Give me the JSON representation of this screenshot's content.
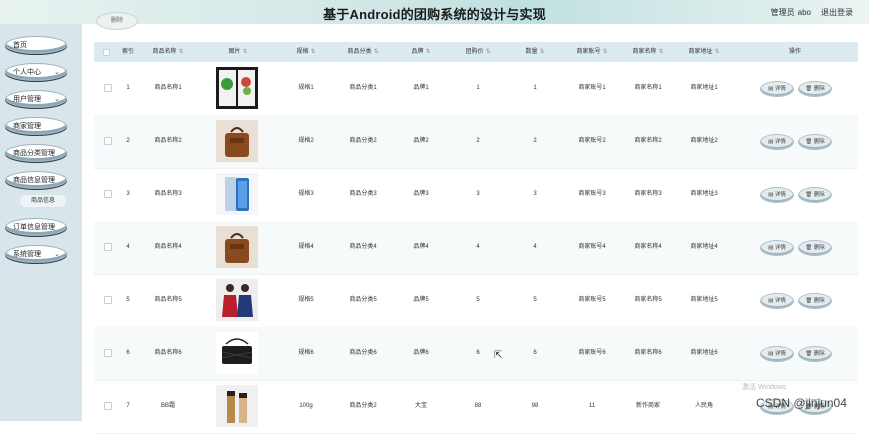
{
  "header": {
    "title": "基于Android的团购系统的设计与实现",
    "role": "管理员",
    "username": "abo",
    "logout": "退出登录"
  },
  "sidebar": {
    "items": [
      {
        "label": "首页",
        "chevron": ""
      },
      {
        "label": "个人中心",
        "chevron": "⌄"
      },
      {
        "label": "用户管理",
        "chevron": "⌄"
      },
      {
        "label": "商家管理",
        "chevron": ""
      },
      {
        "label": "商品分类管理",
        "chevron": ""
      },
      {
        "label": "商品信息管理",
        "chevron": ""
      },
      {
        "label": "订单信息管理",
        "chevron": ""
      },
      {
        "label": "系统管理",
        "chevron": "⌄"
      }
    ],
    "subitem": "商品信息"
  },
  "toolbar": {
    "button": "删除"
  },
  "table": {
    "columns": [
      "",
      "索引",
      "商品名称",
      "图片",
      "规格",
      "商品分类",
      "品牌",
      "团购价",
      "数量",
      "商家账号",
      "商家名称",
      "商家地址",
      "操作"
    ],
    "rows": [
      {
        "idx": "1",
        "name": "商品名称1",
        "image": "vegetables",
        "spec": "规格1",
        "cat": "商品分类1",
        "brand": "品牌1",
        "price": "1",
        "qty": "1",
        "acct": "商家账号1",
        "mname": "商家名称1",
        "addr": "商家地址1"
      },
      {
        "idx": "2",
        "name": "商品名称2",
        "image": "brown-bag",
        "spec": "规格2",
        "cat": "商品分类2",
        "brand": "品牌2",
        "price": "2",
        "qty": "2",
        "acct": "商家账号2",
        "mname": "商家名称2",
        "addr": "商家地址2"
      },
      {
        "idx": "3",
        "name": "商品名称3",
        "image": "phone",
        "spec": "规格3",
        "cat": "商品分类3",
        "brand": "品牌3",
        "price": "3",
        "qty": "3",
        "acct": "商家账号3",
        "mname": "商家名称3",
        "addr": "商家地址3"
      },
      {
        "idx": "4",
        "name": "商品名称4",
        "image": "brown-bag",
        "spec": "规格4",
        "cat": "商品分类4",
        "brand": "品牌4",
        "price": "4",
        "qty": "4",
        "acct": "商家账号4",
        "mname": "商家名称4",
        "addr": "商家地址4"
      },
      {
        "idx": "5",
        "name": "商品名称5",
        "image": "clothing",
        "spec": "规格5",
        "cat": "商品分类5",
        "brand": "品牌5",
        "price": "5",
        "qty": "5",
        "acct": "商家账号5",
        "mname": "商家名称5",
        "addr": "商家地址5"
      },
      {
        "idx": "6",
        "name": "商品名称6",
        "image": "black-bag",
        "spec": "规格6",
        "cat": "商品分类6",
        "brand": "品牌6",
        "price": "6",
        "qty": "6",
        "acct": "商家账号6",
        "mname": "商家名称6",
        "addr": "商家地址6"
      },
      {
        "idx": "7",
        "name": "BB霜",
        "image": "cosmetics",
        "spec": "100g",
        "cat": "商品分类2",
        "brand": "大宝",
        "price": "88",
        "qty": "98",
        "acct": "11",
        "mname": "新作商家",
        "addr": "人民角"
      }
    ],
    "actions": {
      "detail": "详情",
      "delete": "删除"
    }
  },
  "overlay": {
    "watermark": "CSDN @jinjun04",
    "windows": "激活 Windows"
  },
  "colors": {
    "header_bg": "#cfe6e6",
    "sidebar_bg": "#d8e6ec",
    "table_head_bg": "#dcebef"
  }
}
